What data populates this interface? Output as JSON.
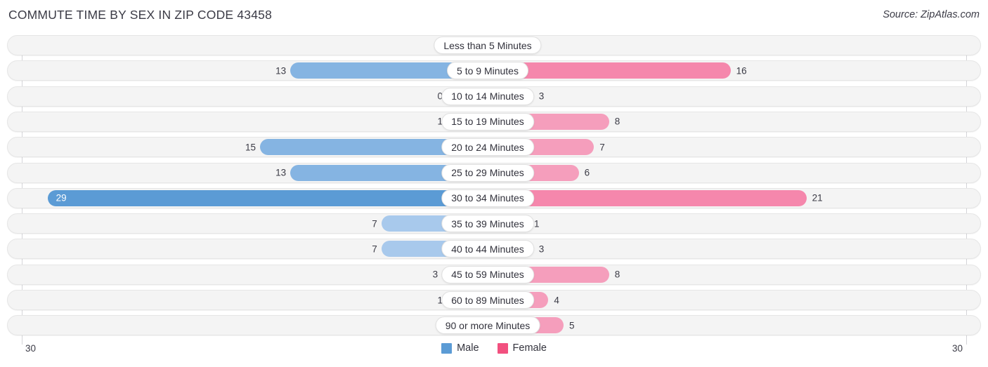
{
  "header": {
    "title": "COMMUTE TIME BY SEX IN ZIP CODE 43458",
    "source": "Source: ZipAtlas.com"
  },
  "axis": {
    "left_label": "30",
    "right_label": "30",
    "max": 30
  },
  "legend": {
    "male_label": "Male",
    "female_label": "Female",
    "male_color": "#5b9bd5",
    "female_color": "#f2507f"
  },
  "chart_data": {
    "type": "bar",
    "subtype": "diverging-bidirectional-bar",
    "title": "COMMUTE TIME BY SEX IN ZIP CODE 43458",
    "xlabel": "",
    "ylabel": "",
    "xlim": [
      30,
      30
    ],
    "grid": false,
    "legend_position": "bottom-center",
    "categories": [
      "Less than 5 Minutes",
      "5 to 9 Minutes",
      "10 to 14 Minutes",
      "15 to 19 Minutes",
      "20 to 24 Minutes",
      "25 to 29 Minutes",
      "30 to 34 Minutes",
      "35 to 39 Minutes",
      "40 to 44 Minutes",
      "45 to 59 Minutes",
      "60 to 89 Minutes",
      "90 or more Minutes"
    ],
    "series": [
      {
        "name": "Male",
        "direction": "left",
        "values": [
          0,
          13,
          0,
          1,
          15,
          13,
          29,
          7,
          7,
          3,
          1,
          0
        ]
      },
      {
        "name": "Female",
        "direction": "right",
        "values": [
          0,
          16,
          3,
          8,
          7,
          6,
          21,
          1,
          3,
          8,
          4,
          5
        ]
      }
    ]
  }
}
